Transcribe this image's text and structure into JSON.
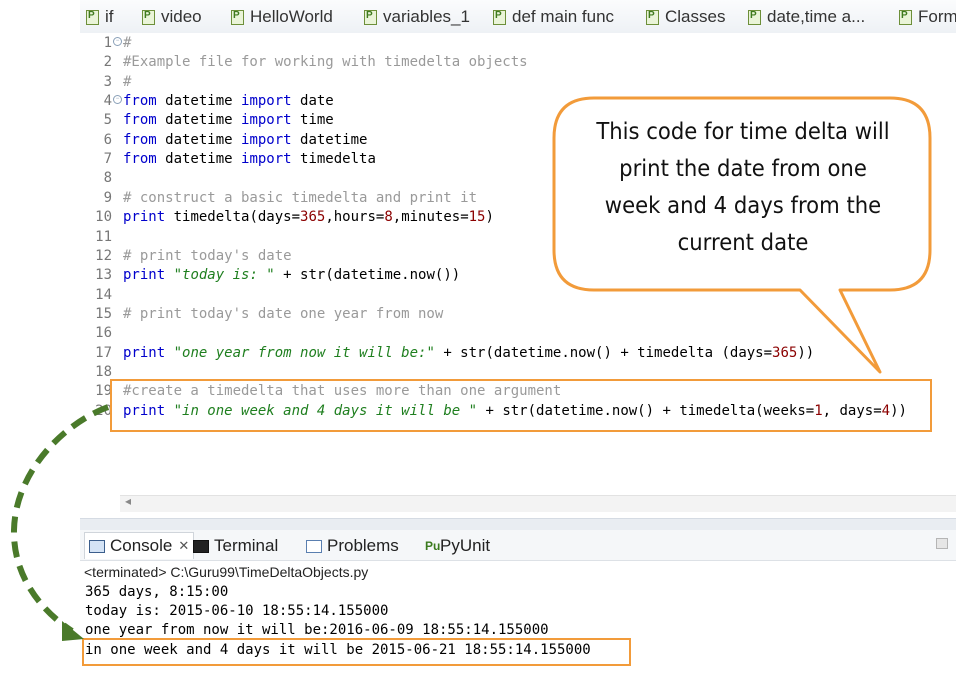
{
  "tabs": [
    {
      "label": "if"
    },
    {
      "label": "video"
    },
    {
      "label": "HelloWorld"
    },
    {
      "label": "variables_1"
    },
    {
      "label": "def main func"
    },
    {
      "label": "Classes"
    },
    {
      "label": "date,time a..."
    },
    {
      "label": "Form"
    }
  ],
  "code_lines": [
    {
      "num": "1",
      "text": "#"
    },
    {
      "num": "2",
      "text": "#Example file for working with timedelta objects"
    },
    {
      "num": "3",
      "text": "#"
    },
    {
      "num": "4",
      "text": "from datetime import date"
    },
    {
      "num": "5",
      "text": "from datetime import time"
    },
    {
      "num": "6",
      "text": "from datetime import datetime"
    },
    {
      "num": "7",
      "text": "from datetime import timedelta"
    },
    {
      "num": "8",
      "text": ""
    },
    {
      "num": "9",
      "text": "# construct a basic timedelta and print it"
    },
    {
      "num": "10",
      "text": "print timedelta(days=365,hours=8,minutes=15)"
    },
    {
      "num": "11",
      "text": ""
    },
    {
      "num": "12",
      "text": "# print today's date"
    },
    {
      "num": "13",
      "text": "print \"today is: \" + str(datetime.now())"
    },
    {
      "num": "14",
      "text": ""
    },
    {
      "num": "15",
      "text": "# print today's date one year from now"
    },
    {
      "num": "16",
      "text": ""
    },
    {
      "num": "17",
      "text": "print \"one year from now it will be:\" + str(datetime.now() + timedelta (days=365))"
    },
    {
      "num": "18",
      "text": ""
    },
    {
      "num": "19",
      "text": "#create a timedelta that uses more than one argument"
    },
    {
      "num": "20",
      "text": "print \"in one week and 4 days it will be \" + str(datetime.now() + timedelta(weeks=1, days=4))"
    }
  ],
  "console": {
    "tabs": [
      {
        "label": "Console"
      },
      {
        "label": "Terminal"
      },
      {
        "label": "Problems"
      },
      {
        "label": "PyUnit"
      }
    ],
    "terminated": "<terminated> C:\\Guru99\\TimeDeltaObjects.py",
    "output": [
      "365 days, 8:15:00",
      "today is: 2015-06-10 18:55:14.155000",
      "one year from now it will be:2016-06-09 18:55:14.155000",
      "in one week and 4 days it will be 2015-06-21 18:55:14.155000"
    ]
  },
  "callout": {
    "text": "This code for time delta will print the date from one week and 4 days from the current date"
  },
  "colors": {
    "highlight": "#f29b3a",
    "arrow": "#4a7a2a",
    "keyword": "#0000cc",
    "comment": "#9a9a9a",
    "string": "#1f7f1f"
  }
}
